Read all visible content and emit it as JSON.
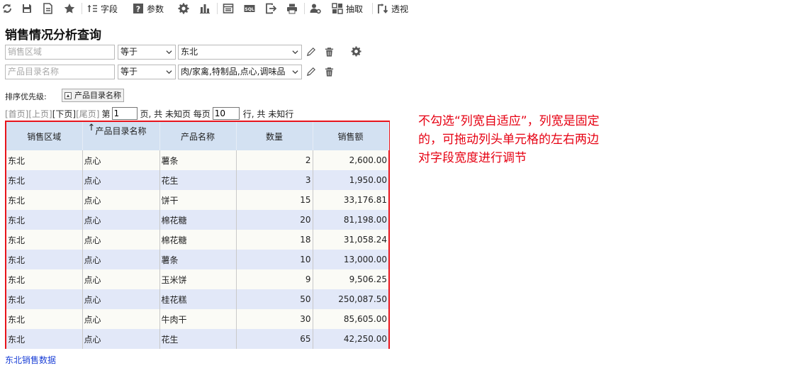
{
  "toolbar": {
    "items": [
      {
        "icon": "refresh-icon"
      },
      {
        "icon": "save-icon"
      },
      {
        "icon": "save-as-icon"
      },
      {
        "icon": "favorite-star-icon"
      },
      {
        "icon": "field-icon",
        "label": "字段"
      },
      {
        "icon": "param-question-icon",
        "label": "参数"
      },
      {
        "icon": "gear-icon"
      },
      {
        "icon": "chart-icon"
      },
      {
        "icon": "layout-icon"
      },
      {
        "icon": "sql-icon",
        "label": "SQL"
      },
      {
        "icon": "export-icon"
      },
      {
        "icon": "print-icon"
      },
      {
        "icon": "user-settings-icon"
      },
      {
        "icon": "extract-icon",
        "label": "抽取"
      },
      {
        "icon": "pivot-icon",
        "label": "透视"
      }
    ]
  },
  "page_title": "销售情况分析查询",
  "conditions": [
    {
      "field_placeholder": "销售区域",
      "operator": "等于",
      "value": "东北"
    },
    {
      "field_placeholder": "产品目录名称",
      "operator": "等于",
      "value": "肉/家禽,特制品,点心,调味品"
    }
  ],
  "sort": {
    "label": "排序优先级:",
    "chip": "产品目录名称"
  },
  "pager": {
    "first": "[首页]",
    "prev": "[上页]",
    "next": "[下页]",
    "last": "[尾页]",
    "page_prefix": "第",
    "page_value": "1",
    "page_suffix": "页, 共 未知页 每页",
    "per_page_value": "10",
    "per_page_suffix": "行, 共 未知行"
  },
  "table": {
    "columns": [
      {
        "label": "销售区域",
        "sort_indicator": ""
      },
      {
        "label": "产品目录名称",
        "sort_indicator": "↑"
      },
      {
        "label": "产品名称",
        "sort_indicator": ""
      },
      {
        "label": "数量",
        "sort_indicator": ""
      },
      {
        "label": "销售额",
        "sort_indicator": ""
      }
    ],
    "rows": [
      [
        "东北",
        "点心",
        "薯条",
        "2",
        "2,600.00"
      ],
      [
        "东北",
        "点心",
        "花生",
        "3",
        "1,950.00"
      ],
      [
        "东北",
        "点心",
        "饼干",
        "15",
        "33,176.81"
      ],
      [
        "东北",
        "点心",
        "棉花糖",
        "20",
        "81,198.00"
      ],
      [
        "东北",
        "点心",
        "棉花糖",
        "18",
        "31,058.24"
      ],
      [
        "东北",
        "点心",
        "薯条",
        "10",
        "13,000.00"
      ],
      [
        "东北",
        "点心",
        "玉米饼",
        "9",
        "9,506.25"
      ],
      [
        "东北",
        "点心",
        "桂花糕",
        "50",
        "250,087.50"
      ],
      [
        "东北",
        "点心",
        "牛肉干",
        "30",
        "85,605.00"
      ],
      [
        "东北",
        "点心",
        "花生",
        "65",
        "42,250.00"
      ]
    ]
  },
  "annotation": "不勾选“列宽自适应”，列宽是固定的，可拖动列头单元格的左右两边对字段宽度进行调节",
  "footer_link": "东北销售数据",
  "colors": {
    "header_bg": "#d3e1f2",
    "row_even": "#e2e8f8",
    "highlight": "#e8141b",
    "link": "#1a3fd6"
  }
}
